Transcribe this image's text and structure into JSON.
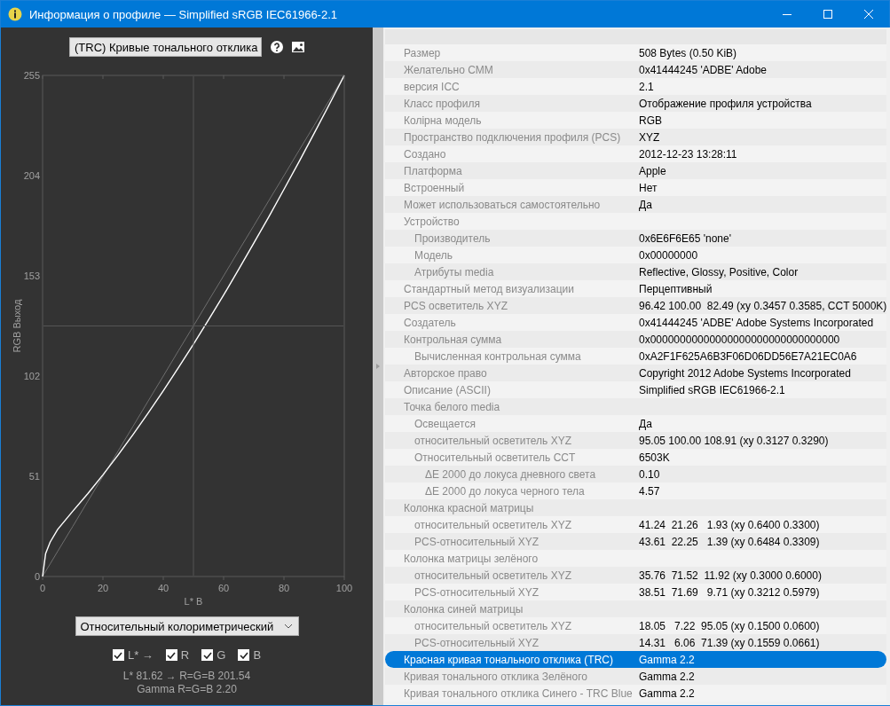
{
  "window": {
    "title": "Информация о профиле — Simplified sRGB IEC61966-2.1"
  },
  "left_panel": {
    "curve_select": {
      "value": "(TRC) Кривые тонального отклика"
    },
    "chart": {
      "chart_data": {
        "type": "line",
        "xlabel": "L* B",
        "ylabel": "RGB Выход",
        "x": [
          0,
          1,
          2.5,
          5,
          10,
          15,
          20,
          25,
          30,
          35,
          40,
          45,
          50,
          55,
          60,
          65,
          70,
          75,
          80,
          85,
          90,
          95,
          100
        ],
        "series": [
          {
            "color": "#ffffff",
            "values": [
              0,
              11.6,
              17.5,
              24.0,
              33.2,
              42.2,
              51.7,
              61.8,
              72.3,
              83.2,
              94.5,
              106.2,
              118.2,
              130.6,
              143.2,
              156.3,
              169.6,
              183.1,
              197.0,
              211.1,
              225.5,
              240.1,
              255
            ]
          },
          {
            "color": "#6e6e6e",
            "values": [
              0,
              2.6,
              6.4,
              12.8,
              25.5,
              38.3,
              51,
              63.8,
              76.5,
              89.3,
              102,
              114.8,
              127.5,
              140.3,
              153,
              165.8,
              178.5,
              191.3,
              204,
              216.8,
              229.5,
              242.3,
              255
            ]
          }
        ],
        "ref_lines": [
          {
            "axis": "x",
            "value": 50
          },
          {
            "axis": "y",
            "value": 127.5
          }
        ],
        "xlim": [
          0,
          100
        ],
        "ylim": [
          0,
          255
        ],
        "xticks": [
          0,
          20,
          40,
          60,
          80,
          100
        ],
        "yticks": [
          0,
          51,
          102,
          153,
          204,
          255
        ]
      }
    },
    "intent_select": {
      "value": "Относительный колориметрический"
    },
    "toggles": [
      {
        "label": "L* →",
        "checked": true
      },
      {
        "label": "R",
        "checked": true
      },
      {
        "label": "G",
        "checked": true
      },
      {
        "label": "B",
        "checked": true
      }
    ],
    "readout": [
      "L* 81.62 → R=G=B 201.54",
      "Gamma R=G=B 2.20"
    ]
  },
  "properties": {
    "rows": [
      {
        "label": "Размер",
        "value": "508 Bytes (0.50 KiB)",
        "selected": false
      },
      {
        "label": "Желательно CMM",
        "value": "0x41444245 'ADBE' Adobe",
        "selected": false
      },
      {
        "label": "версия ICC",
        "value": "2.1",
        "selected": false
      },
      {
        "label": "Класс профиля",
        "value": "Отображение профиля устройства",
        "selected": false
      },
      {
        "label": "Колірна модель",
        "value": "RGB",
        "selected": false
      },
      {
        "label": "Пространство подключения профиля (PCS)",
        "value": "XYZ",
        "selected": false
      },
      {
        "label": "Создано",
        "value": "2012-12-23 13:28:11",
        "selected": false
      },
      {
        "label": "Платформа",
        "value": "Apple",
        "selected": false
      },
      {
        "label": "Встроенный",
        "value": "Нет",
        "selected": false
      },
      {
        "label": "Может использоваться самостоятельно",
        "value": "Да",
        "selected": false
      },
      {
        "label": "Устройство",
        "selected": false,
        "children": [
          {
            "label": "Производитель",
            "value": "0x6E6F6E65 'none'",
            "selected": false
          },
          {
            "label": "Модель",
            "value": "0x00000000",
            "selected": false
          },
          {
            "label": "Атрибуты media",
            "value": "Reflective, Glossy, Positive, Color",
            "selected": false
          }
        ]
      },
      {
        "label": "Стандартный метод визуализации",
        "value": "Перцептивный",
        "selected": false
      },
      {
        "label": "PCS осветитель XYZ",
        "value": "96.42 100.00  82.49 (xy 0.3457 0.3585, CCT 5000K)",
        "selected": false
      },
      {
        "label": "Создатель",
        "value": "0x41444245 'ADBE' Adobe Systems Incorporated",
        "selected": false
      },
      {
        "label": "Контрольная сумма",
        "value": "0x00000000000000000000000000000000",
        "selected": false,
        "children": [
          {
            "label": "Вычисленная контрольная сумма",
            "value": "0xA2F1F625A6B3F06D06DD56E7A21EC0A6",
            "selected": false
          }
        ]
      },
      {
        "label": "Авторское право",
        "value": "Copyright 2012 Adobe Systems Incorporated",
        "selected": false
      },
      {
        "label": "Описание (ASCII)",
        "value": "Simplified sRGB IEC61966-2.1",
        "selected": false
      },
      {
        "label": "Точка белого media",
        "selected": false,
        "children": [
          {
            "label": "Освещается",
            "value": "Да",
            "selected": false
          },
          {
            "label": "относительный осветитель XYZ",
            "value": "95.05 100.00 108.91 (xy 0.3127 0.3290)",
            "selected": false
          },
          {
            "label": "Относительный осветитель CCT",
            "value": "6503K",
            "selected": false,
            "children": [
              {
                "label": "ΔE 2000 до локуса дневного света",
                "value": "0.10",
                "selected": false
              },
              {
                "label": "ΔE 2000 до локуса черного тела",
                "value": "4.57",
                "selected": false
              }
            ]
          }
        ]
      },
      {
        "label": "Колонка красной матрицы",
        "selected": false,
        "children": [
          {
            "label": "относительный осветитель XYZ",
            "value": "41.24  21.26   1.93 (xy 0.6400 0.3300)",
            "selected": false
          },
          {
            "label": "PCS-относительный XYZ",
            "value": "43.61  22.25   1.39 (xy 0.6484 0.3309)",
            "selected": false
          }
        ]
      },
      {
        "label": "Колонка матрицы зелёного",
        "selected": false,
        "children": [
          {
            "label": "относительный осветитель XYZ",
            "value": "35.76  71.52  11.92 (xy 0.3000 0.6000)",
            "selected": false
          },
          {
            "label": "PCS-относительный XYZ",
            "value": "38.51  71.69   9.71 (xy 0.3212 0.5979)",
            "selected": false
          }
        ]
      },
      {
        "label": "Колонка синей матрицы",
        "selected": false,
        "children": [
          {
            "label": "относительный осветитель XYZ",
            "value": "18.05   7.22  95.05 (xy 0.1500 0.0600)",
            "selected": false
          },
          {
            "label": "PCS-относительный XYZ",
            "value": "14.31   6.06  71.39 (xy 0.1559 0.0661)",
            "selected": false
          }
        ]
      },
      {
        "label": "Красная кривая тонального отклика (TRC)",
        "value": "Gamma 2.2",
        "selected": true
      },
      {
        "label": "Кривая тонального отклика Зелёного",
        "value": "Gamma 2.2",
        "selected": false
      },
      {
        "label": "Кривая тонального отклика Синего - TRC Blue",
        "value": "Gamma 2.2",
        "selected": false
      }
    ]
  }
}
